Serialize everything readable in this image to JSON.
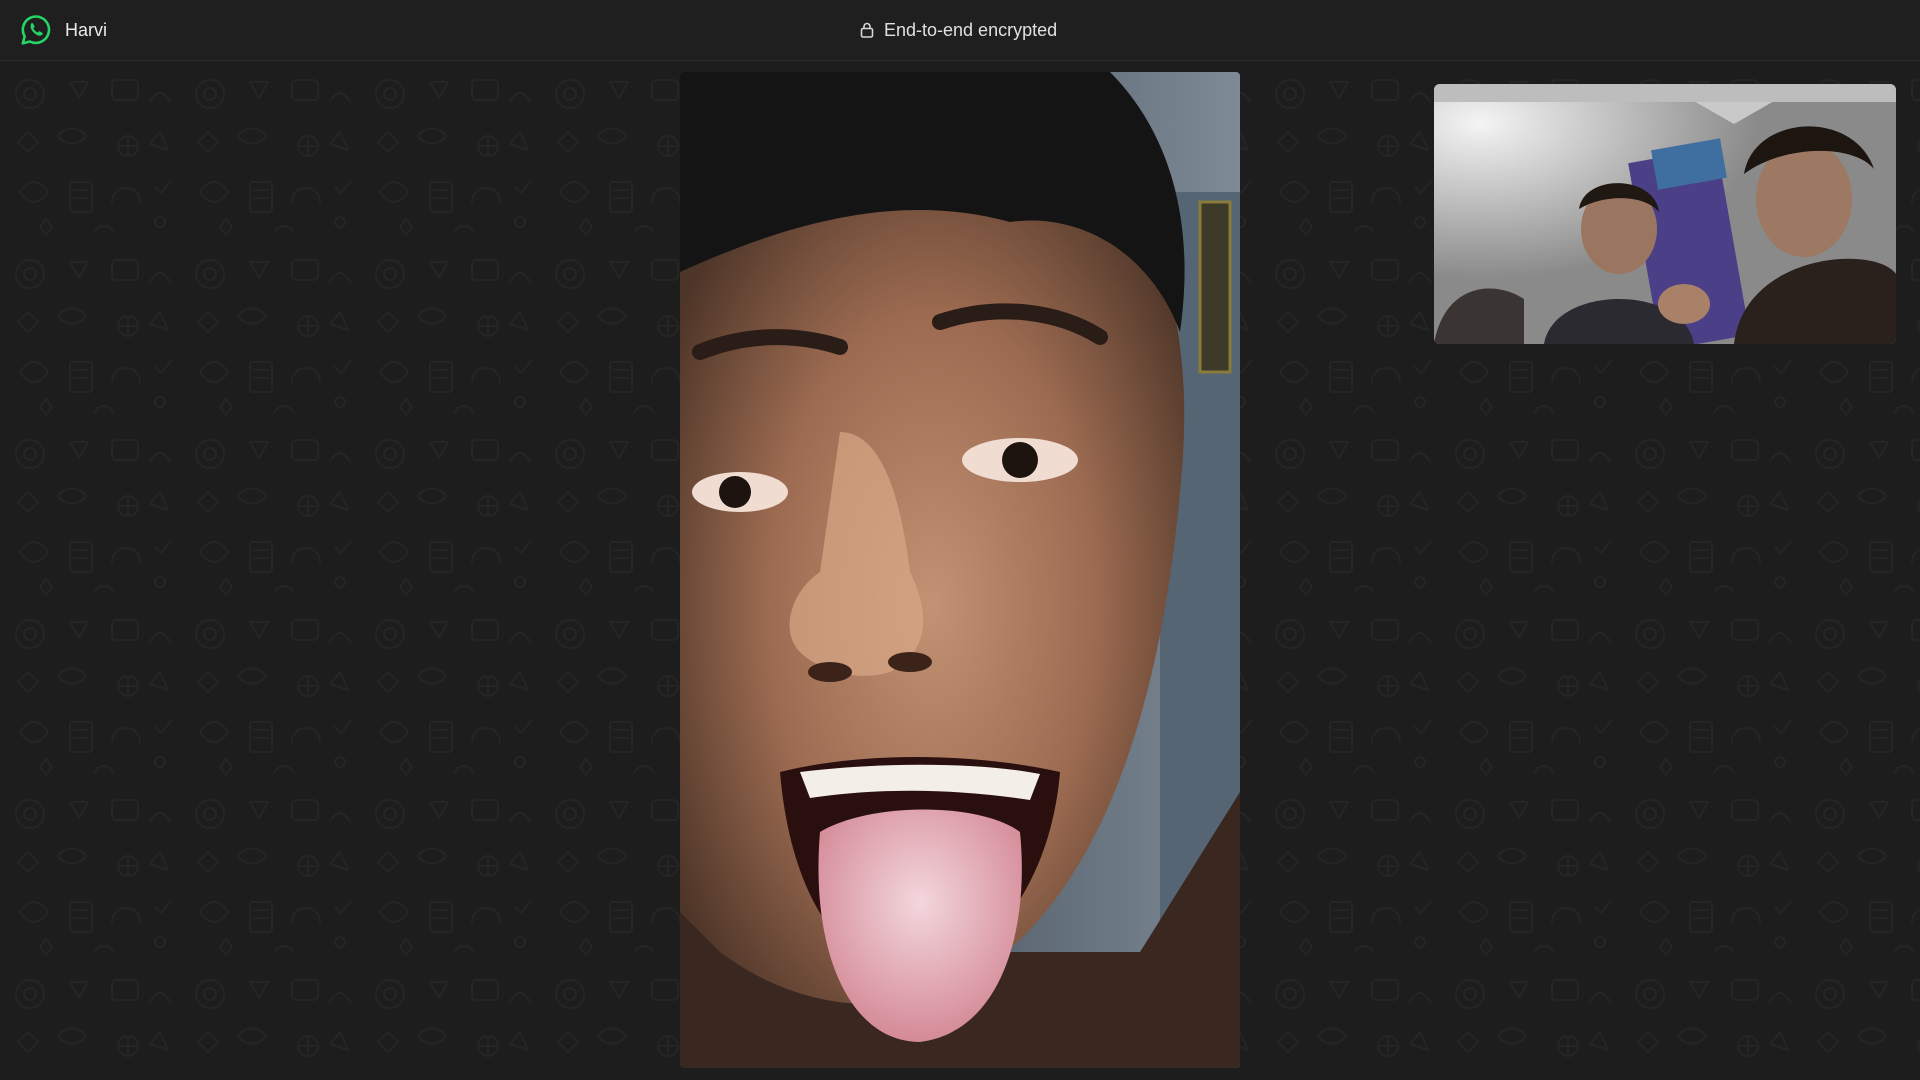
{
  "app": {
    "name": "WhatsApp",
    "logo_icon": "whatsapp-logo-icon",
    "accent_color": "#25d366"
  },
  "call": {
    "contact_name": "Harvi",
    "encryption_label": "End-to-end encrypted",
    "encryption_icon": "lock-icon"
  },
  "videos": {
    "remote": {
      "description_icon": "remote-video-feed"
    },
    "local": {
      "description_icon": "self-view-video-feed"
    }
  },
  "colors": {
    "background": "#1f1f1f",
    "text": "#e9e9e9"
  }
}
